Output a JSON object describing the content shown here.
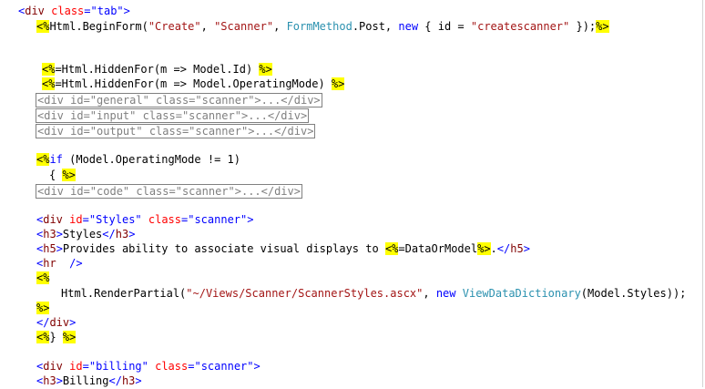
{
  "colors": {
    "markup_tag": "#800000",
    "markup_bracket": "#0000ff",
    "attribute": "#ff0000",
    "attribute_value": "#0000ff",
    "string": "#a31515",
    "keyword": "#0000ff",
    "type": "#2b91af",
    "server_tag_highlight": "#ffff00",
    "collapsed_region": "#808080"
  },
  "lines": {
    "l1": {
      "lt": "<",
      "tag": "div",
      "attr": "class",
      "eq": "=",
      "val": "\"tab\"",
      "gt": ">"
    },
    "l2": {
      "open": "<%",
      "t1": "Html.BeginForm(",
      "s1": "\"Create\"",
      "t2": ", ",
      "s2": "\"Scanner\"",
      "t3": ", ",
      "typ": "FormMethod",
      "t4": ".Post, ",
      "kw": "new",
      "t5": " { id = ",
      "s3": "\"createscanner\"",
      "t6": " });",
      "close": "%>"
    },
    "l3": {
      "open": "<%",
      "code": "=Html.HiddenFor(m => Model.Id) ",
      "close": "%>"
    },
    "l4": {
      "open": "<%",
      "code": "=Html.HiddenFor(m => Model.OperatingMode) ",
      "close": "%>"
    },
    "l5": {
      "collapsed": "<div id=\"general\" class=\"scanner\">...</div>"
    },
    "l6": {
      "collapsed": "<div id=\"input\" class=\"scanner\">...</div>"
    },
    "l7": {
      "collapsed": "<div id=\"output\" class=\"scanner\">...</div>"
    },
    "l8": {
      "open": "<%",
      "kw": "if",
      "code": " (Model.OperatingMode != 1)"
    },
    "l9": {
      "code": "{ ",
      "close": "%>"
    },
    "l10": {
      "collapsed": "<div id=\"code\" class=\"scanner\">...</div>"
    },
    "l11": {
      "lt": "<",
      "tag": "div",
      "attr1": "id",
      "eq1": "=",
      "val1": "\"Styles\"",
      "attr2": "class",
      "eq2": "=",
      "val2": "\"scanner\"",
      "gt": ">"
    },
    "l12": {
      "lt1": "<",
      "tag1": "h3",
      "gt1": ">",
      "text": "Styles",
      "lt2": "</",
      "tag2": "h3",
      "gt2": ">"
    },
    "l13": {
      "lt1": "<",
      "tag1": "h5",
      "gt1": ">",
      "text1": "Provides ability to associate visual displays to ",
      "open": "<%",
      "code": "=DataOrModel",
      "close": "%>",
      "text2": ".",
      "lt2": "</",
      "tag2": "h5",
      "gt2": ">"
    },
    "l14": {
      "lt": "<",
      "tag": "hr",
      "sp": "  ",
      "gt": "/>"
    },
    "l15": {
      "open": "<%"
    },
    "l16": {
      "t1": "Html.RenderPartial(",
      "s1": "\"~/Views/Scanner/ScannerStyles.ascx\"",
      "t2": ", ",
      "kw": "new",
      "t3": " ",
      "typ": "ViewDataDictionary",
      "t4": "(Model.Styles));"
    },
    "l17": {
      "close": "%>"
    },
    "l18": {
      "lt": "</",
      "tag": "div",
      "gt": ">"
    },
    "l19": {
      "open": "<%",
      "code": "} ",
      "close": "%>"
    },
    "l20": {
      "lt": "<",
      "tag": "div",
      "attr1": "id",
      "eq1": "=",
      "val1": "\"billing\"",
      "attr2": "class",
      "eq2": "=",
      "val2": "\"scanner\"",
      "gt": ">"
    },
    "l21": {
      "lt1": "<",
      "tag1": "h3",
      "gt1": ">",
      "text": "Billing",
      "lt2": "</",
      "tag2": "h3",
      "gt2": ">"
    }
  }
}
